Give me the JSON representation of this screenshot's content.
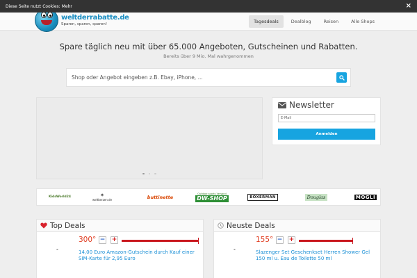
{
  "cookie": {
    "text": "Diese Seite nutzt Cookies:",
    "more": "Mehr",
    "close": "×"
  },
  "logo": {
    "name": "weltderrabatte.de",
    "slogan": "Sparen, sparen, sparen!"
  },
  "nav": [
    {
      "label": "Tagesdeals",
      "active": true
    },
    {
      "label": "Dealblog"
    },
    {
      "label": "Reisen"
    },
    {
      "label": "Alle Shops"
    }
  ],
  "hero": {
    "headline": "Spare täglich neu mit über 65.000 Angeboten, Gutscheinen und Rabatten.",
    "subline": "Bereits über 9 Mio. Mal wahrgenommen"
  },
  "search": {
    "placeholder": "Shop oder Angebot eingeben z.B. Ebay, iPhone, ..."
  },
  "slider": {
    "slides": 3,
    "active": 1
  },
  "newsletter": {
    "title": "Newsletter",
    "email_placeholder": "E-Mail",
    "button": "Anmelden"
  },
  "shops": {
    "kids": "KidsWorld24",
    "wolf": "weltkerzen.de",
    "buttinette": "buttinette",
    "dw_top": "Outdoor sports Versand",
    "dw_main": "DW-SHOP",
    "boxerman": "BOXERMAN",
    "douglas": "Douglas",
    "mogli": "MOGLI"
  },
  "top_deals": {
    "title": "Top Deals",
    "deal": {
      "thumb": "-",
      "degree": "300°",
      "heat": 1.0,
      "title": "14,00 Euro Amazon-Gutschein durch Kauf einer SIM-Karte für 2,95 Euro"
    }
  },
  "new_deals": {
    "title": "Neuste Deals",
    "deal": {
      "thumb": "-",
      "degree": "155°",
      "heat": 0.7,
      "title": "Slazenger Set Geschenkset Herren Shower Gel 150 ml u. Eau de Toilette 50 ml"
    }
  },
  "colors": {
    "accent": "#17a4e0",
    "heat": "#c9181f",
    "link": "#1a8fd6",
    "degree": "#e03a1e"
  }
}
